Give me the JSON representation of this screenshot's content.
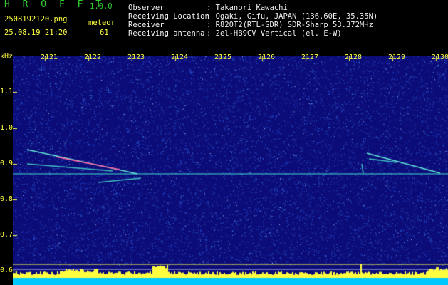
{
  "header": {
    "brand": "H R O F F T",
    "version": "1.0.0",
    "filename": "2508192120.png",
    "datetime": "25.08.19 21:20",
    "meteor_label": "meteor",
    "meteor_count": "61",
    "observer_label": "Observer",
    "observer_value": ": Takanori Kawachi",
    "location_label": "Receiving Location",
    "location_value": ": Ogaki, Gifu, JAPAN (136.60E, 35.35N)",
    "receiver_label": "Receiver",
    "receiver_value": ": R820T2(RTL-SDR) SDR-Sharp 53.372MHz",
    "antenna_label": "Receiving antenna",
    "antenna_value": ": 2el-HB9CV Vertical (el. E-W)"
  },
  "y_axis": {
    "unit": "kHz",
    "ticks": [
      "1.1",
      "1.0",
      "0.9",
      "0.8",
      "0.7",
      "0.6"
    ]
  },
  "x_axis": {
    "ticks": [
      "2121",
      "2122",
      "2123",
      "2124",
      "2125",
      "2126",
      "2127",
      "2128",
      "2129",
      "2130"
    ]
  },
  "colors": {
    "background": "#0c0c78",
    "noise": "#3a8fff",
    "trail": "#40e0d0",
    "yellow": "#ffff40"
  }
}
